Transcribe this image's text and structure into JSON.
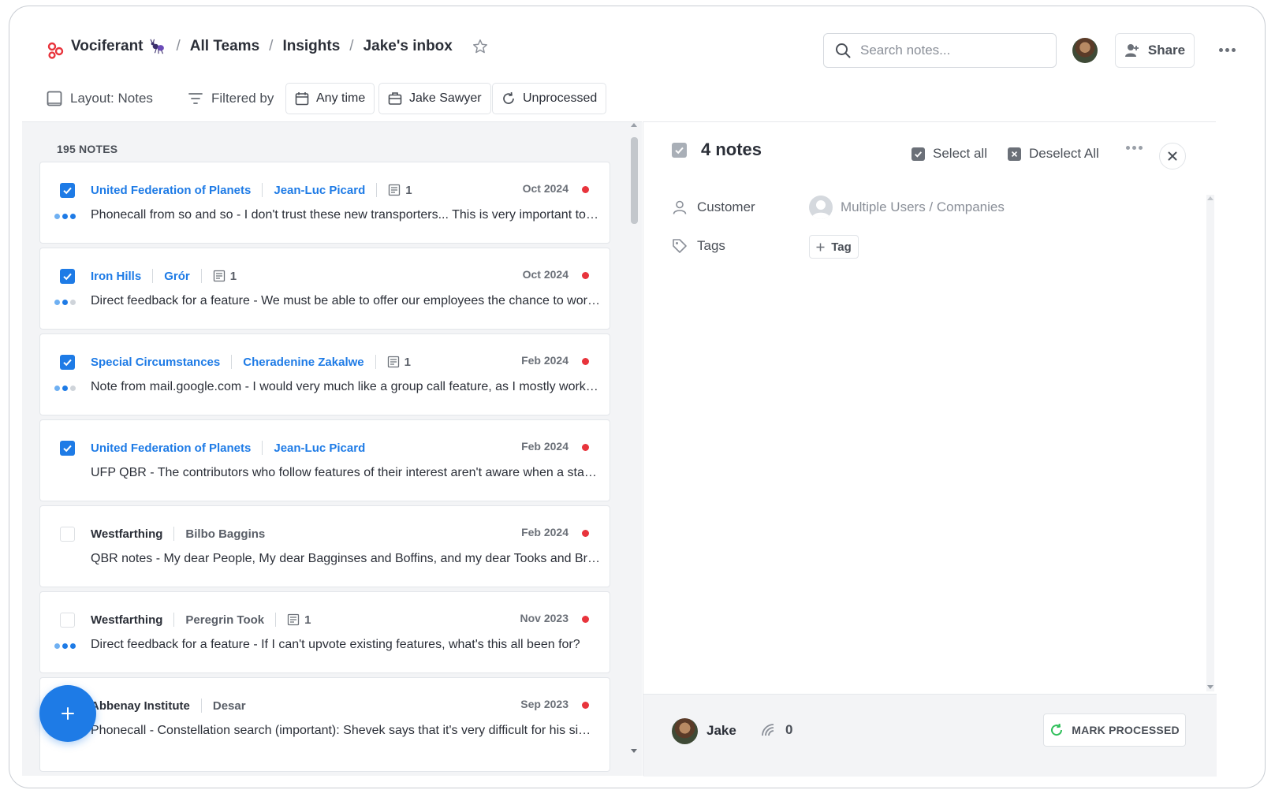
{
  "header": {
    "brand": "Vociferant",
    "crumbs": [
      "All Teams",
      "Insights",
      "Jake's inbox"
    ],
    "search_placeholder": "Search notes...",
    "share_label": "Share"
  },
  "filters": {
    "layout_label": "Layout: Notes",
    "filtered_label": "Filtered by",
    "time": "Any time",
    "owner": "Jake Sawyer",
    "status": "Unprocessed"
  },
  "list": {
    "count_label": "195 NOTES",
    "notes": [
      {
        "company": "United Federation of Planets",
        "person": "Jean-Luc Picard",
        "note_count": "1",
        "date": "Oct 2024",
        "text": "Phonecall from so and so - I don't trust these new transporters... This is very important to me. I need this fixed",
        "selected": true
      },
      {
        "company": "Iron Hills",
        "person": "Grór",
        "note_count": "1",
        "date": "Oct 2024",
        "text": "Direct feedback for a feature - We must be able to offer our employees the chance to work from home",
        "selected": true
      },
      {
        "company": "Special Circumstances",
        "person": "Cheradenine Zakalwe",
        "note_count": "1",
        "date": "Feb 2024",
        "text": "Note from mail.google.com - I would very much like a group call feature, as I mostly work with teams",
        "selected": true
      },
      {
        "company": "United Federation of Planets",
        "person": "Jean-Luc Picard",
        "note_count": "",
        "date": "Feb 2024",
        "text": "UFP QBR - The contributors who follow features of their interest aren't aware when a status changes",
        "selected": true
      },
      {
        "company": "Westfarthing",
        "person": "Bilbo Baggins",
        "note_count": "",
        "date": "Feb 2024",
        "text": "QBR notes - My dear People, My dear Bagginses and Boffins, and my dear Tooks and Brandybucks",
        "selected": false
      },
      {
        "company": "Westfarthing",
        "person": "Peregrin Took",
        "note_count": "1",
        "date": "Nov 2023",
        "text": "Direct feedback for a feature - If I can't upvote existing features, what's this all been for?",
        "selected": false
      },
      {
        "company": "Abbenay Institute",
        "person": "Desar",
        "note_count": "",
        "date": "Sep 2023",
        "text": "Phonecall - Constellation search (important): Shevek says that it's very difficult for his simultaneity work",
        "selected": false
      }
    ]
  },
  "detail": {
    "title": "4 notes",
    "select_all": "Select all",
    "deselect_all": "Deselect All",
    "customer_label": "Customer",
    "customer_value": "Multiple Users / Companies",
    "tags_label": "Tags",
    "tag_button": "Tag",
    "owner_name": "Jake",
    "impact_count": "0",
    "mark_processed": "MARK PROCESSED"
  },
  "colors": {
    "accent": "#1e7be6",
    "unread": "#e8343c",
    "processed_icon": "#2fbf5a"
  },
  "icons": [
    "brand-logo-icon",
    "ant-icon",
    "star-icon",
    "search-icon",
    "share-user-icon",
    "more-icon",
    "layout-icon",
    "filter-icon",
    "calendar-icon",
    "briefcase-icon",
    "refresh-icon",
    "checkbox-icon",
    "note-icon",
    "user-icon",
    "tag-icon",
    "close-icon",
    "signal-icon",
    "plus-icon"
  ]
}
